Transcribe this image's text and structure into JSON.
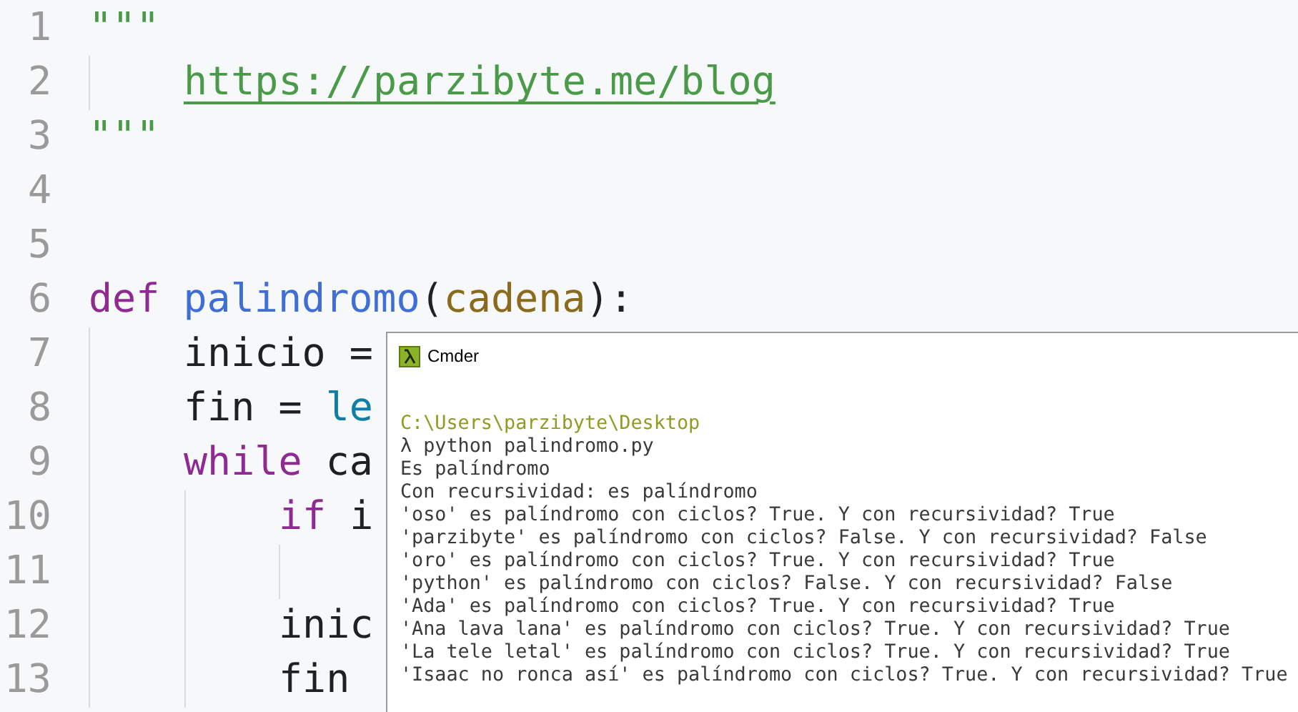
{
  "editor": {
    "lines": [
      {
        "number": "1",
        "tokens": [
          {
            "kind": "string",
            "text": "\"\"\""
          }
        ],
        "children": [
          {
            "number": "2",
            "tokens": [
              {
                "kind": "link",
                "text": "https://parzibyte.me/blog"
              }
            ]
          }
        ]
      },
      {
        "number": "3",
        "tokens": [
          {
            "kind": "string",
            "text": "\"\"\""
          }
        ]
      },
      {
        "number": "4"
      },
      {
        "number": "5"
      },
      {
        "number": "6",
        "tokens": [
          {
            "kind": "keyword",
            "text": "def "
          },
          {
            "kind": "function",
            "text": "palindromo"
          },
          {
            "kind": "plain",
            "text": "("
          },
          {
            "kind": "param",
            "text": "cadena"
          },
          {
            "kind": "plain",
            "text": "):"
          }
        ],
        "children": [
          {
            "number": "7",
            "tokens": [
              {
                "kind": "plain",
                "text": "inicio ="
              }
            ]
          },
          {
            "number": "8",
            "tokens": [
              {
                "kind": "plain",
                "text": "fin = "
              },
              {
                "kind": "builtin",
                "text": "le"
              }
            ]
          },
          {
            "number": "9",
            "tokens": [
              {
                "kind": "keyword",
                "text": "while"
              },
              {
                "kind": "plain",
                "text": " ca"
              }
            ],
            "children": [
              {
                "number": "10",
                "tokens": [
                  {
                    "kind": "keyword",
                    "text": "if"
                  },
                  {
                    "kind": "plain",
                    "text": " i"
                  }
                ],
                "children": [
                  {
                    "number": "11"
                  }
                ]
              },
              {
                "number": "12",
                "tokens": [
                  {
                    "kind": "plain",
                    "text": "inic"
                  }
                ]
              },
              {
                "number": "13",
                "tokens": [
                  {
                    "kind": "plain",
                    "text": "fin"
                  }
                ]
              }
            ]
          }
        ]
      }
    ]
  },
  "terminal": {
    "title": "Cmder",
    "lines": [
      {
        "kind": "path",
        "text": "C:\\Users\\parzibyte\\Desktop"
      },
      {
        "kind": "output",
        "text": "λ python palindromo.py"
      },
      {
        "kind": "output",
        "text": "Es palíndromo"
      },
      {
        "kind": "output",
        "text": "Con recursividad: es palíndromo"
      },
      {
        "kind": "output",
        "text": "'oso' es palíndromo con ciclos? True. Y con recursividad? True"
      },
      {
        "kind": "output",
        "text": "'parzibyte' es palíndromo con ciclos? False. Y con recursividad? False"
      },
      {
        "kind": "output",
        "text": "'oro' es palíndromo con ciclos? True. Y con recursividad? True"
      },
      {
        "kind": "output",
        "text": "'python' es palíndromo con ciclos? False. Y con recursividad? False"
      },
      {
        "kind": "output",
        "text": "'Ada' es palíndromo con ciclos? True. Y con recursividad? True"
      },
      {
        "kind": "output",
        "text": "'Ana lava lana' es palíndromo con ciclos? True. Y con recursividad? True"
      },
      {
        "kind": "output",
        "text": "'La tele letal' es palíndromo con ciclos? True. Y con recursividad? True"
      },
      {
        "kind": "output",
        "text": "'Isaac no ronca así' es palíndromo con ciclos? True. Y con recursividad? True"
      }
    ]
  }
}
